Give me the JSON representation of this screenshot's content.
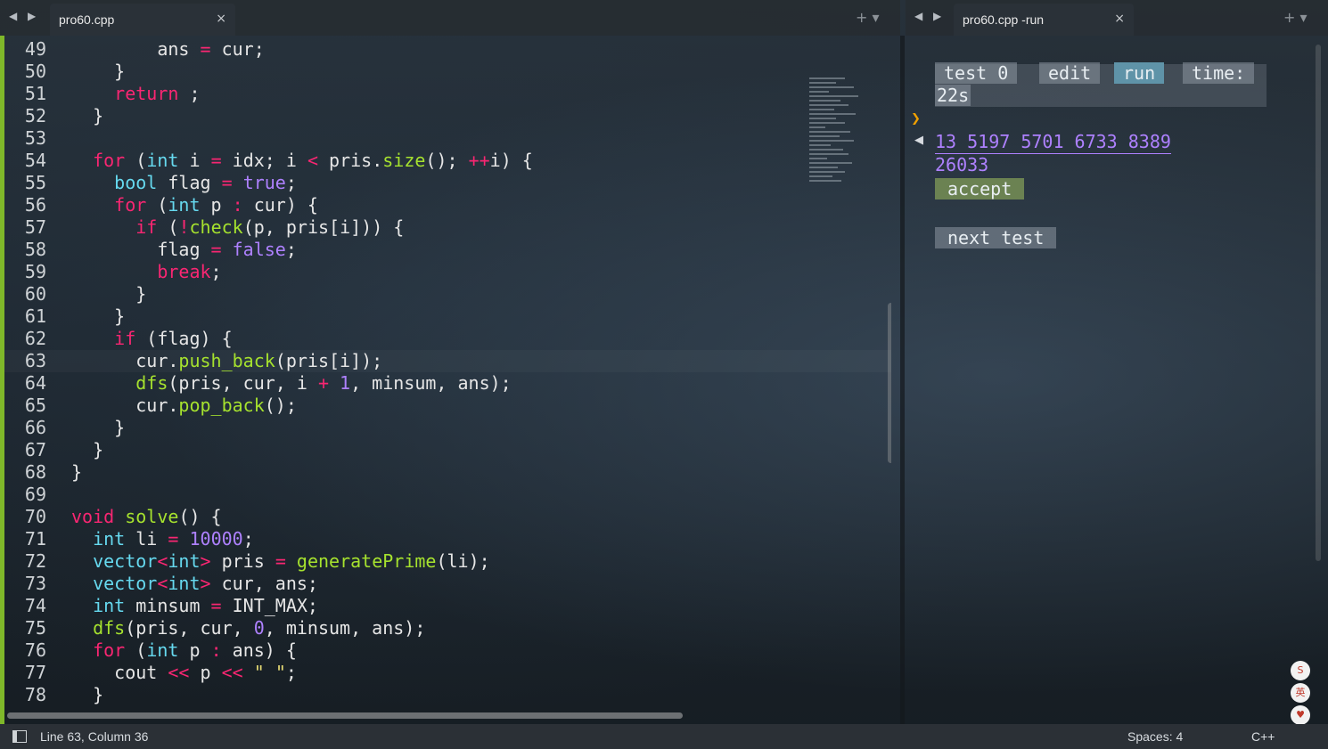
{
  "tabs": {
    "left": {
      "title": "pro60.cpp",
      "close": "×"
    },
    "right": {
      "title": "pro60.cpp -run",
      "close": "×"
    },
    "nav": "◀ ▶",
    "controls": "+ ▾"
  },
  "editor": {
    "current_line": 63,
    "lines": [
      {
        "n": "49",
        "code": "        ans = cur;"
      },
      {
        "n": "50",
        "code": "    }"
      },
      {
        "n": "51",
        "code": "    return ;"
      },
      {
        "n": "52",
        "code": "  }"
      },
      {
        "n": "53",
        "code": ""
      },
      {
        "n": "54",
        "code": "  for (int i = idx; i < pris.size(); ++i) {"
      },
      {
        "n": "55",
        "code": "    bool flag = true;"
      },
      {
        "n": "56",
        "code": "    for (int p : cur) {"
      },
      {
        "n": "57",
        "code": "      if (!check(p, pris[i])) {"
      },
      {
        "n": "58",
        "code": "        flag = false;"
      },
      {
        "n": "59",
        "code": "        break;"
      },
      {
        "n": "60",
        "code": "      }"
      },
      {
        "n": "61",
        "code": "    }"
      },
      {
        "n": "62",
        "code": "    if (flag) {"
      },
      {
        "n": "63",
        "code": "      cur.push_back(pris[i]);"
      },
      {
        "n": "64",
        "code": "      dfs(pris, cur, i + 1, minsum, ans);"
      },
      {
        "n": "65",
        "code": "      cur.pop_back();"
      },
      {
        "n": "66",
        "code": "    }"
      },
      {
        "n": "67",
        "code": "  }"
      },
      {
        "n": "68",
        "code": "}"
      },
      {
        "n": "69",
        "code": ""
      },
      {
        "n": "70",
        "code": "void solve() {"
      },
      {
        "n": "71",
        "code": "  int li = 10000;"
      },
      {
        "n": "72",
        "code": "  vector<int> pris = generatePrime(li);"
      },
      {
        "n": "73",
        "code": "  vector<int> cur, ans;"
      },
      {
        "n": "74",
        "code": "  int minsum = INT_MAX;"
      },
      {
        "n": "75",
        "code": "  dfs(pris, cur, 0, minsum, ans);"
      },
      {
        "n": "76",
        "code": "  for (int p : ans) {"
      },
      {
        "n": "77",
        "code": "    cout << p << \" \";"
      },
      {
        "n": "78",
        "code": "  }"
      }
    ]
  },
  "run_panel": {
    "test_label": "test 0",
    "edit_label": "edit",
    "run_label": "run",
    "time_label": "time:",
    "time_value": "22s",
    "output_line1": "13 5197 5701 6733 8389",
    "output_line2": "26033",
    "accept_label": "accept",
    "next_test_label": "next test"
  },
  "status": {
    "position": "Line 63, Column 36",
    "spaces": "Spaces: 4",
    "language": "C++"
  },
  "tray": [
    "S",
    "英",
    "♥"
  ],
  "colors": {
    "keyword": "#f92672",
    "type": "#66d9ef",
    "function": "#a6e22e",
    "number": "#ae81ff",
    "string": "#e6db74",
    "accent_bar": "#7fb82a",
    "run_button": "#5f93a8",
    "accept_button": "#6b8252"
  }
}
